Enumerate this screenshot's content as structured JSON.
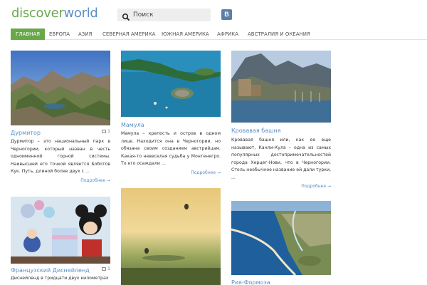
{
  "logo": {
    "part1": "discover",
    "part2": "world"
  },
  "search": {
    "placeholder": "Поиск"
  },
  "social": {
    "vk_label": "В"
  },
  "nav": {
    "items": [
      {
        "label": "ГЛАВНАЯ",
        "active": true
      },
      {
        "label": "ЕВРОПА"
      },
      {
        "label": "АЗИЯ"
      },
      {
        "label": "СЕВЕРНАЯ АМЕРИКА"
      },
      {
        "label": "ЮЖНАЯ АМЕРИКА"
      },
      {
        "label": "АФРИКА"
      },
      {
        "label": "АВСТРАЛИЯ И ОКЕАНИЯ"
      }
    ]
  },
  "posts": [
    {
      "title": "Дурмитор",
      "comments": "1",
      "text": "Дурмитор – это национальный парк в Черногории, который назван в честь одноименной горной системы. Наивысшей его точкой является Боботов Кук. Путь, длиной более двух с ...",
      "more": "Подробнее →"
    },
    {
      "title": "Мамула",
      "text": "Мамула – крепость и остров в одном лице. Находится она в Черногории, но обязана своим созданием австрийцам. Какая-то невеселая судьба у Монтенегро. То его осаждали ...",
      "more": "Подробнее →"
    },
    {
      "title": "Кровавая башня",
      "text": "Кровавая башня или, как ее еще называют, Канли-Кула – одна из самых популярных достопримечательностей города Херцег-Нови, что в Черногории. Столь необычное название ей дали турки, ...",
      "more": "Подробнее →"
    },
    {
      "title": "Французский Диснейленд",
      "comments": "1",
      "text": "Диснейленд в тридцати двух километрах"
    },
    {
      "title": "Рия-Формоза"
    }
  ],
  "colors": {
    "accent_green": "#69a84a",
    "link_blue": "#5b8fc7"
  }
}
